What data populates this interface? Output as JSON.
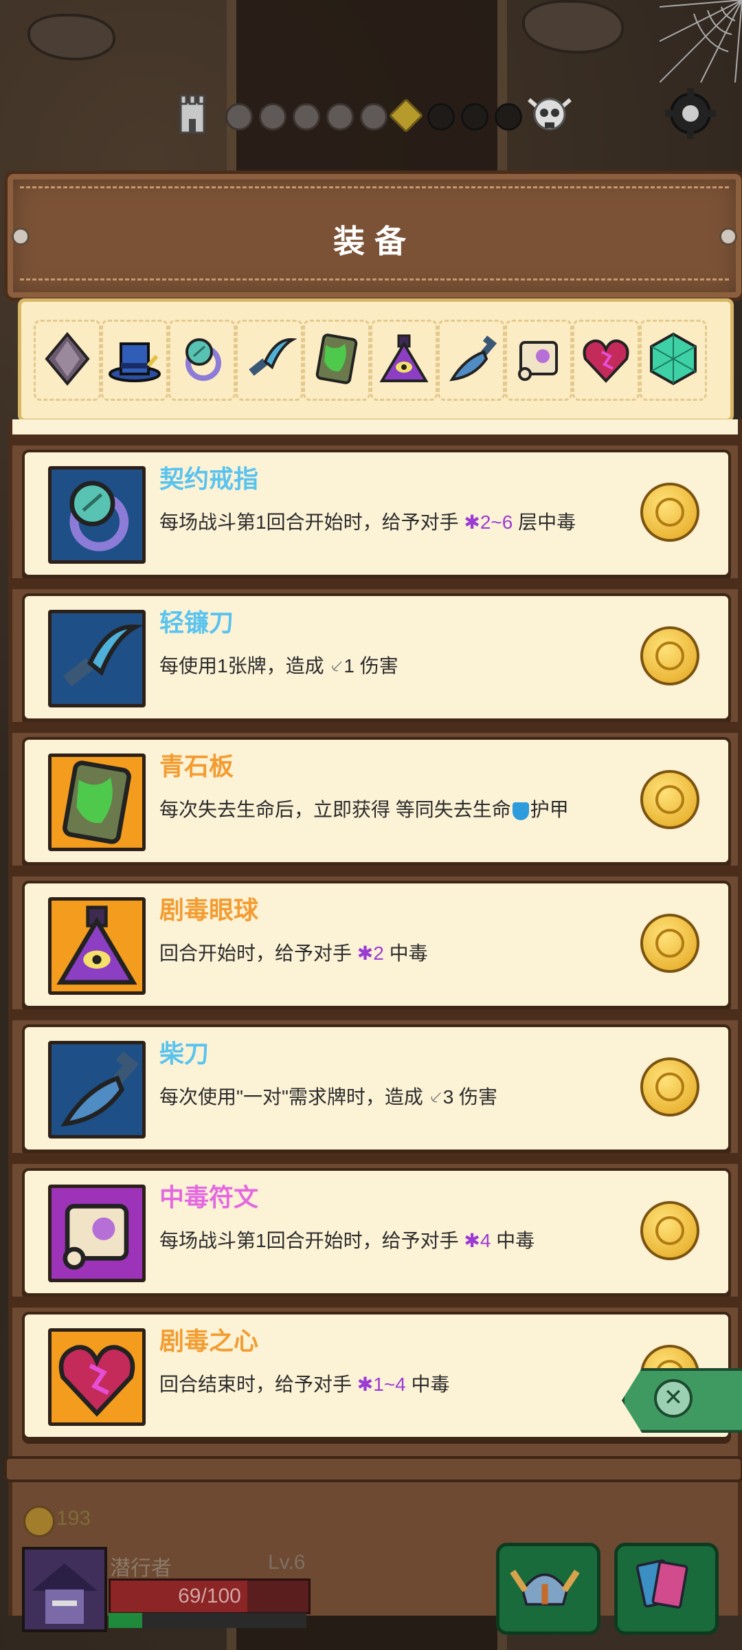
{
  "header": {
    "title": "装备"
  },
  "progress": {
    "nodes": [
      "done",
      "done",
      "done",
      "done",
      "done",
      "current",
      "future",
      "future",
      "future"
    ]
  },
  "tray": {
    "items": [
      "diamond-icon",
      "hat-icon",
      "ring-icon",
      "sickle-icon",
      "slate-icon",
      "potion-icon",
      "cleaver-icon",
      "scroll-icon",
      "heart-icon",
      "crystal-icon"
    ]
  },
  "equipment": [
    {
      "name": "契约戒指",
      "name_color": "#59c3ef",
      "bg": "#1e4f86",
      "icon": "ring-icon",
      "desc_pre": "每场战斗第1回合开始时，给予对手 ",
      "glyph": "✱",
      "value": "2~6",
      "desc_post": " 层中毒"
    },
    {
      "name": "轻镰刀",
      "name_color": "#59c3ef",
      "bg": "#1e4f86",
      "icon": "sickle-icon",
      "desc_pre": "每使用1张牌，造成 ",
      "glyph": "⸔",
      "value": "1",
      "desc_post": " 伤害",
      "glyph_type": "sword"
    },
    {
      "name": "青石板",
      "name_color": "#f39c30",
      "bg": "#f39c1e",
      "icon": "slate-icon",
      "desc_pre": "每次失去生命后，立即获得 等同失去生命",
      "glyph_type": "shield",
      "desc_post": "护甲"
    },
    {
      "name": "剧毒眼球",
      "name_color": "#f39c30",
      "bg": "#f39c1e",
      "icon": "potion-icon",
      "desc_pre": "回合开始时，给予对手 ",
      "glyph": "✱",
      "value": "2",
      "desc_post": " 中毒"
    },
    {
      "name": "柴刀",
      "name_color": "#59c3ef",
      "bg": "#1e4f86",
      "icon": "cleaver-icon",
      "desc_pre": "每次使用\"一对\"需求牌时，造成 ",
      "glyph": "⸔",
      "value": "3",
      "desc_post": " 伤害",
      "glyph_type": "sword"
    },
    {
      "name": "中毒符文",
      "name_color": "#e468e0",
      "bg": "#9c33b8",
      "icon": "scroll-icon",
      "desc_pre": "每场战斗第1回合开始时，给予对手 ",
      "glyph": "✱",
      "value": "4",
      "desc_post": " 中毒"
    },
    {
      "name": "剧毒之心",
      "name_color": "#f39c30",
      "bg": "#f39c1e",
      "icon": "heart-icon",
      "desc_pre": "回合结束时，给予对手 ",
      "glyph": "✱",
      "value": "1~4",
      "desc_post": " 中毒"
    }
  ],
  "player": {
    "gold": "193",
    "name": "潜行者",
    "level": "Lv.6",
    "hp_text": "69/100",
    "hp_fraction": 0.69,
    "xp_fraction": 0.17
  },
  "buttons": {
    "close": "close-icon",
    "hero": "helmet-icon",
    "deck": "cards-icon"
  }
}
